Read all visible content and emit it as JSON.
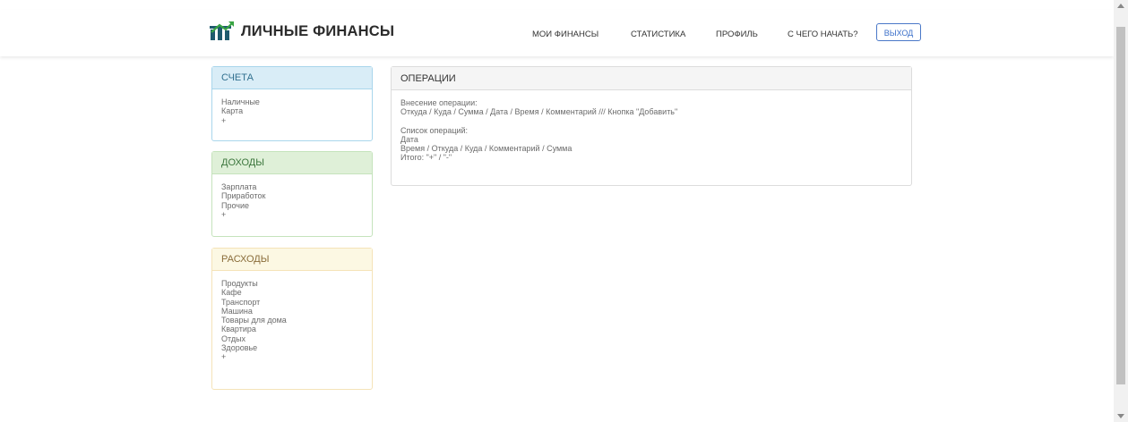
{
  "header": {
    "brand": "ЛИЧНЫЕ ФИНАНСЫ",
    "logo_icon": "bar-growth-icon",
    "nav": [
      "МОИ ФИНАНСЫ",
      "СТАТИСТИКА",
      "ПРОФИЛЬ",
      "С ЧЕГО НАЧАТЬ?"
    ],
    "logout": "ВЫХОД"
  },
  "accounts": {
    "title": "СЧЕТА",
    "items": [
      "Наличные",
      "Карта",
      "+"
    ]
  },
  "income": {
    "title": "ДОХОДЫ",
    "items": [
      "Зарплата",
      "Приработок",
      "Прочие",
      "+"
    ]
  },
  "expenses": {
    "title": "РАСХОДЫ",
    "items": [
      "Продукты",
      "Кафе",
      "Транспорт",
      "Машина",
      "Товары для дома",
      "Квартира",
      "Отдых",
      "Здоровье",
      "+"
    ]
  },
  "operations": {
    "title": "ОПЕРАЦИИ",
    "lines_a": [
      "Внесение операции:",
      "Откуда / Куда / Сумма / Дата / Время / Комментарий /// Кнопка \"Добавить\""
    ],
    "lines_b": [
      "Список операций:",
      "Дата",
      "Время / Откуда / Куда / Комментарий / Сумма",
      "Итого: \"+\" / \"-\""
    ]
  },
  "colors": {
    "accounts_head": "#d9edf7",
    "income_head": "#dff0d8",
    "expenses_head": "#fcf8e3",
    "logout_border": "#4a78c8"
  }
}
